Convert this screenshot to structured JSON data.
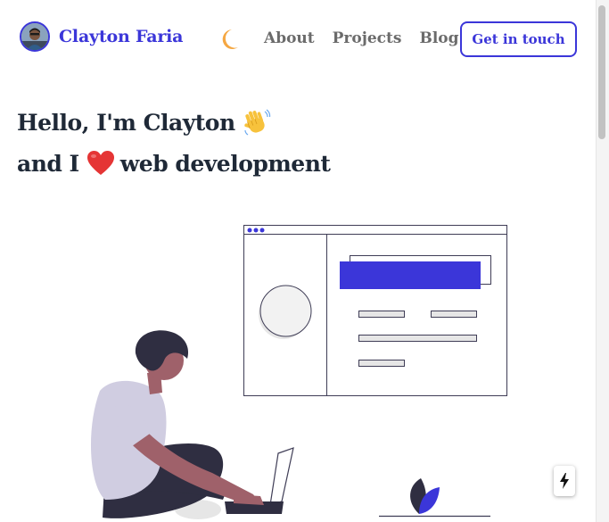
{
  "brand": {
    "name": "Clayton Faria"
  },
  "nav": {
    "about": "About",
    "projects": "Projects",
    "blog": "Blog"
  },
  "header": {
    "cta": "Get in touch"
  },
  "hero": {
    "line1": "Hello, I'm Clayton",
    "line2_start": "and I",
    "line2_end": "web development"
  },
  "icons": {
    "theme_toggle": "moon-icon",
    "greeting": "waving-hand-icon",
    "love": "heart-icon",
    "float_action": "lightning-icon"
  },
  "colors": {
    "accent": "#3b36d9",
    "moon": "#f5a742",
    "heart": "#e53535",
    "heading": "#1f2937",
    "nav": "#6b6b6b"
  }
}
